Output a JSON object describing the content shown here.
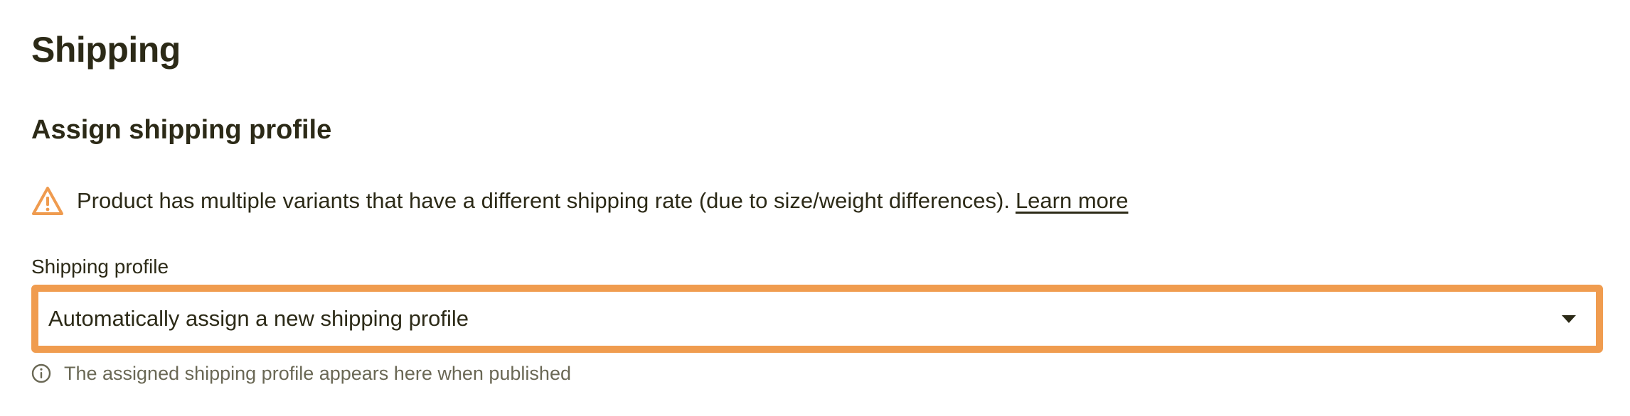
{
  "section": {
    "title": "Shipping"
  },
  "shipping_profile": {
    "subtitle": "Assign shipping profile",
    "warning": {
      "icon": "warning-triangle-icon",
      "text": "Product has multiple variants that have a different shipping rate (due to size/weight differences).",
      "link_label": "Learn more"
    },
    "field": {
      "label": "Shipping profile",
      "selected_value": "Automatically assign a new shipping profile",
      "help_icon": "info-circle-icon",
      "help_text": "The assigned shipping profile appears here when published"
    }
  },
  "colors": {
    "text": "#2c2a17",
    "accent_border": "#f09c4f",
    "warning_icon": "#ef9b4f",
    "muted_text": "#6a6855"
  }
}
